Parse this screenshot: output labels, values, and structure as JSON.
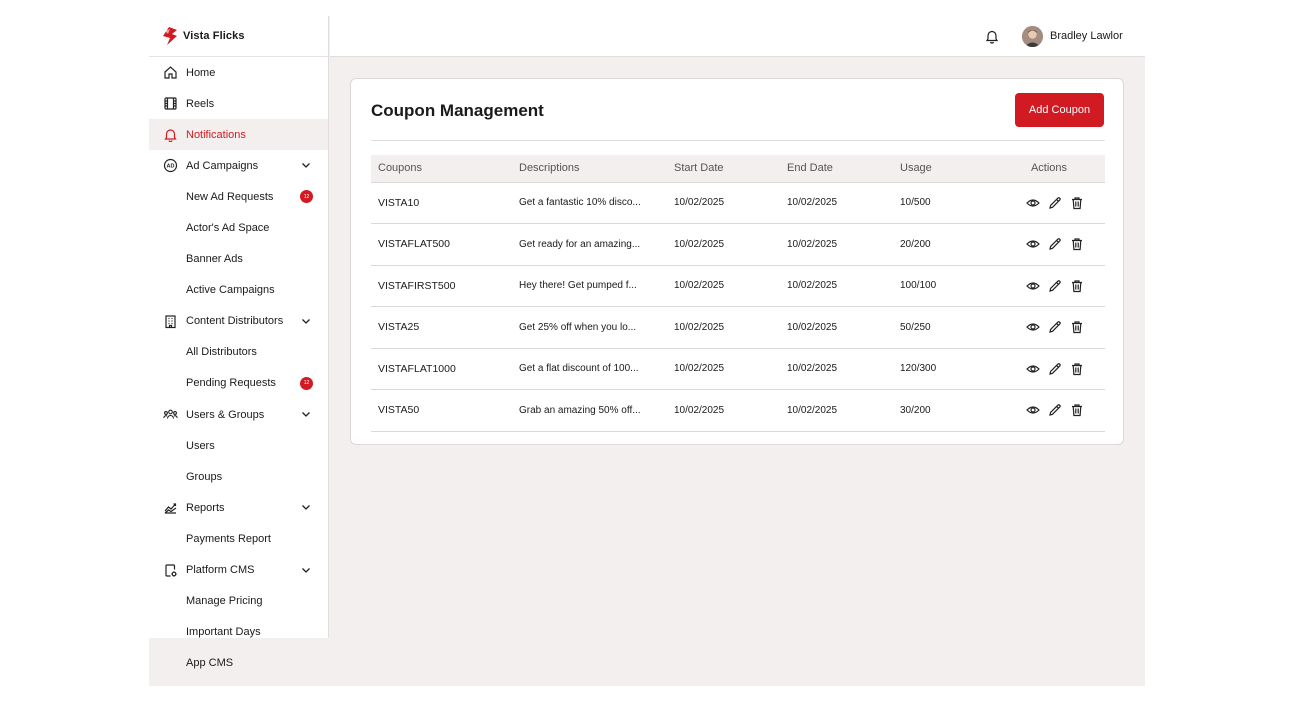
{
  "brand": {
    "name": "Vista Flicks",
    "accent": "#d11a22"
  },
  "sidebar": {
    "items": [
      {
        "label": "Home",
        "icon": "home-icon",
        "level": "top"
      },
      {
        "label": "Reels",
        "icon": "film-icon",
        "level": "top"
      },
      {
        "label": "Notifications",
        "icon": "bell-icon",
        "level": "top",
        "active": true
      },
      {
        "label": "Ad Campaigns",
        "icon": "ad-icon",
        "level": "top",
        "expandable": true
      },
      {
        "label": "New Ad Requests",
        "level": "sub",
        "badge": "12"
      },
      {
        "label": "Actor's Ad Space",
        "level": "sub"
      },
      {
        "label": "Banner Ads",
        "level": "sub"
      },
      {
        "label": "Active Campaigns",
        "level": "sub"
      },
      {
        "label": "Content Distributors",
        "icon": "building-icon",
        "level": "top",
        "expandable": true
      },
      {
        "label": "All Distributors",
        "level": "sub"
      },
      {
        "label": "Pending Requests",
        "level": "sub",
        "badge": "12"
      },
      {
        "label": "Users & Groups",
        "icon": "users-icon",
        "level": "top",
        "expandable": true
      },
      {
        "label": "Users",
        "level": "sub"
      },
      {
        "label": "Groups",
        "level": "sub"
      },
      {
        "label": "Reports",
        "icon": "chart-icon",
        "level": "top",
        "expandable": true
      },
      {
        "label": "Payments Report",
        "level": "sub"
      },
      {
        "label": "Platform CMS",
        "icon": "device-settings-icon",
        "level": "top",
        "expandable": true
      },
      {
        "label": "Manage Pricing",
        "level": "sub"
      },
      {
        "label": "Important Days",
        "level": "sub"
      },
      {
        "label": "App CMS",
        "level": "sub"
      }
    ]
  },
  "header": {
    "user_name": "Bradley Lawlor"
  },
  "main": {
    "title": "Coupon Management",
    "add_button": "Add Coupon",
    "columns": [
      "Coupons",
      "Descriptions",
      "Start Date",
      "End Date",
      "Usage",
      "Actions"
    ],
    "rows": [
      {
        "code": "VISTA10",
        "description": "Get a fantastic 10% disco...",
        "start": "10/02/2025",
        "end": "10/02/2025",
        "usage": "10/500"
      },
      {
        "code": "VISTAFLAT500",
        "description": "Get ready for an amazing...",
        "start": "10/02/2025",
        "end": "10/02/2025",
        "usage": "20/200"
      },
      {
        "code": "VISTAFIRST500",
        "description": "Hey there! Get pumped f...",
        "start": "10/02/2025",
        "end": "10/02/2025",
        "usage": "100/100"
      },
      {
        "code": "VISTA25",
        "description": "Get 25% off when you lo...",
        "start": "10/02/2025",
        "end": "10/02/2025",
        "usage": "50/250"
      },
      {
        "code": "VISTAFLAT1000",
        "description": "Get a flat discount of 100...",
        "start": "10/02/2025",
        "end": "10/02/2025",
        "usage": "120/300"
      },
      {
        "code": "VISTA50",
        "description": "Grab an amazing 50% off...",
        "start": "10/02/2025",
        "end": "10/02/2025",
        "usage": "30/200"
      }
    ],
    "row_actions": [
      "eye-icon",
      "pencil-icon",
      "trash-icon"
    ]
  }
}
